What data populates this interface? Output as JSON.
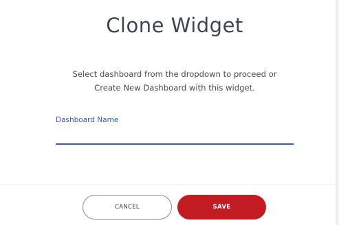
{
  "dialog": {
    "title": "Clone Widget",
    "description_line1": "Select dashboard from the dropdown to proceed or",
    "description_line2": "Create New Dashboard with this widget.",
    "field": {
      "label": "Dashboard Name",
      "value": "",
      "placeholder": ""
    },
    "buttons": {
      "cancel_label": "CANCEL",
      "save_label": "SAVE"
    }
  },
  "colors": {
    "accent_blue": "#3b58b8",
    "save_red": "#c21b22",
    "title_text": "#3d4650"
  }
}
